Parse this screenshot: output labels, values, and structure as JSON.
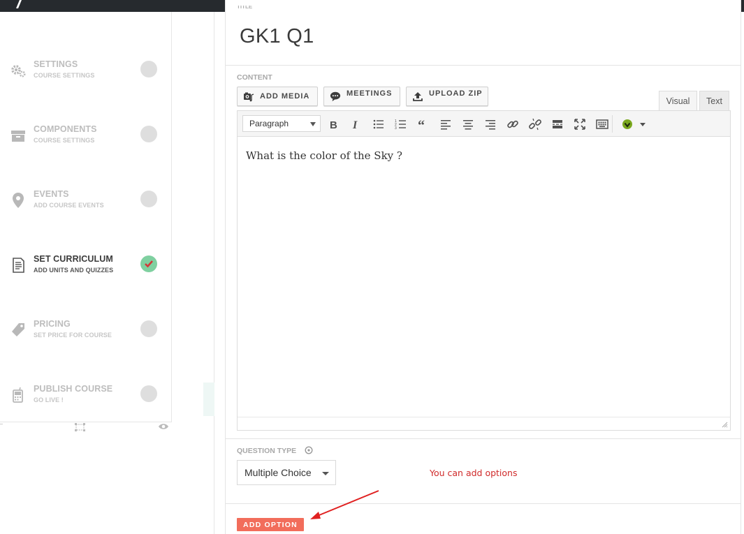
{
  "title": {
    "label": "TITLE",
    "value": "GK1 Q1"
  },
  "sidebar": {
    "steps": [
      {
        "title": "SETTINGS",
        "subtitle": "COURSE SETTINGS",
        "icon": "gears-icon",
        "complete": false
      },
      {
        "title": "COMPONENTS",
        "subtitle": "COURSE SETTINGS",
        "icon": "box-icon",
        "complete": false
      },
      {
        "title": "EVENTS",
        "subtitle": "ADD COURSE EVENTS",
        "icon": "map-pin-icon",
        "complete": false
      },
      {
        "title": "SET CURRICULUM",
        "subtitle": "ADD UNITS AND QUIZZES",
        "icon": "document-icon",
        "complete": true
      },
      {
        "title": "PRICING",
        "subtitle": "SET PRICE FOR COURSE",
        "icon": "tag-icon",
        "complete": false
      },
      {
        "title": "PUBLISH COURSE",
        "subtitle": "GO LIVE !",
        "icon": "phone-icon",
        "complete": false
      }
    ]
  },
  "content": {
    "label": "CONTENT",
    "buttons": {
      "add_media": "ADD MEDIA",
      "meetings": "MEETINGS",
      "upload_zip": "UPLOAD ZIP"
    },
    "tabs": {
      "visual": "Visual",
      "text": "Text"
    },
    "format_select": "Paragraph",
    "body_text": "What is the color of the Sky ?"
  },
  "question_type": {
    "label": "QUESTION TYPE",
    "value": "Multiple Choice"
  },
  "annotation": "You can add options",
  "add_option_label": "ADD OPTION",
  "colors": {
    "accent": "#f26d5b",
    "complete": "#7fd0a0",
    "annotation": "#d02a2a",
    "topbar": "#262a2e"
  }
}
